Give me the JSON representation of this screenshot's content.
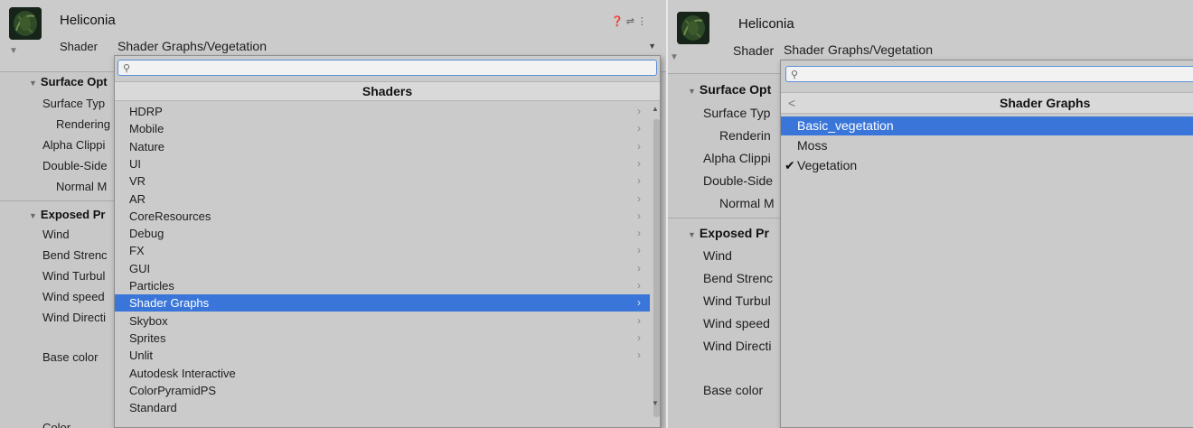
{
  "left": {
    "object_name": "Heliconia",
    "shader_label": "Shader",
    "shader_value": "Shader Graphs/Vegetation",
    "sections": {
      "surface_options": "Surface Opt",
      "exposed_properties": "Exposed Pr"
    },
    "surface_props": [
      "Surface Typ",
      "Rendering",
      "Alpha Clippi",
      "Double-Side",
      "Normal M"
    ],
    "exposed_props": [
      "Wind",
      "Bend Strenc",
      "Wind Turbul",
      "Wind speed",
      "Wind Directi",
      "Base color"
    ],
    "color_label": "Color",
    "popup": {
      "header": "Shaders",
      "search_placeholder": "",
      "items": [
        {
          "label": "HDRP",
          "submenu": true
        },
        {
          "label": "Mobile",
          "submenu": true
        },
        {
          "label": "Nature",
          "submenu": true
        },
        {
          "label": "UI",
          "submenu": true
        },
        {
          "label": "VR",
          "submenu": true
        },
        {
          "label": "AR",
          "submenu": true
        },
        {
          "label": "CoreResources",
          "submenu": true
        },
        {
          "label": "Debug",
          "submenu": true
        },
        {
          "label": "FX",
          "submenu": true
        },
        {
          "label": "GUI",
          "submenu": true
        },
        {
          "label": "Particles",
          "submenu": true
        },
        {
          "label": "Shader Graphs",
          "submenu": true,
          "selected": true
        },
        {
          "label": "Skybox",
          "submenu": true
        },
        {
          "label": "Sprites",
          "submenu": true
        },
        {
          "label": "Unlit",
          "submenu": true
        },
        {
          "label": "Autodesk Interactive",
          "submenu": false
        },
        {
          "label": "ColorPyramidPS",
          "submenu": false
        },
        {
          "label": "Standard",
          "submenu": false
        }
      ]
    }
  },
  "right": {
    "object_name": "Heliconia",
    "shader_label": "Shader",
    "shader_value": "Shader Graphs/Vegetation",
    "sections": {
      "surface_options": "Surface Opt",
      "exposed_properties": "Exposed Pr"
    },
    "surface_props": [
      "Surface Typ",
      "Renderin",
      "Alpha Clippi",
      "Double-Side",
      "Normal M"
    ],
    "exposed_props": [
      "Wind",
      "Bend Strenc",
      "Wind Turbul",
      "Wind speed",
      "Wind Directi",
      "Base color"
    ],
    "popup": {
      "header": "Shader Graphs",
      "back_glyph": "<",
      "items": [
        {
          "label": "Basic_vegetation",
          "selected": true,
          "checked": false
        },
        {
          "label": "Moss",
          "selected": false,
          "checked": false
        },
        {
          "label": "Vegetation",
          "selected": false,
          "checked": true
        }
      ]
    }
  },
  "colors": {
    "selection": "#3a76d9",
    "panel_bg": "#c8c8c8",
    "popup_bg": "#cbcbcb"
  }
}
